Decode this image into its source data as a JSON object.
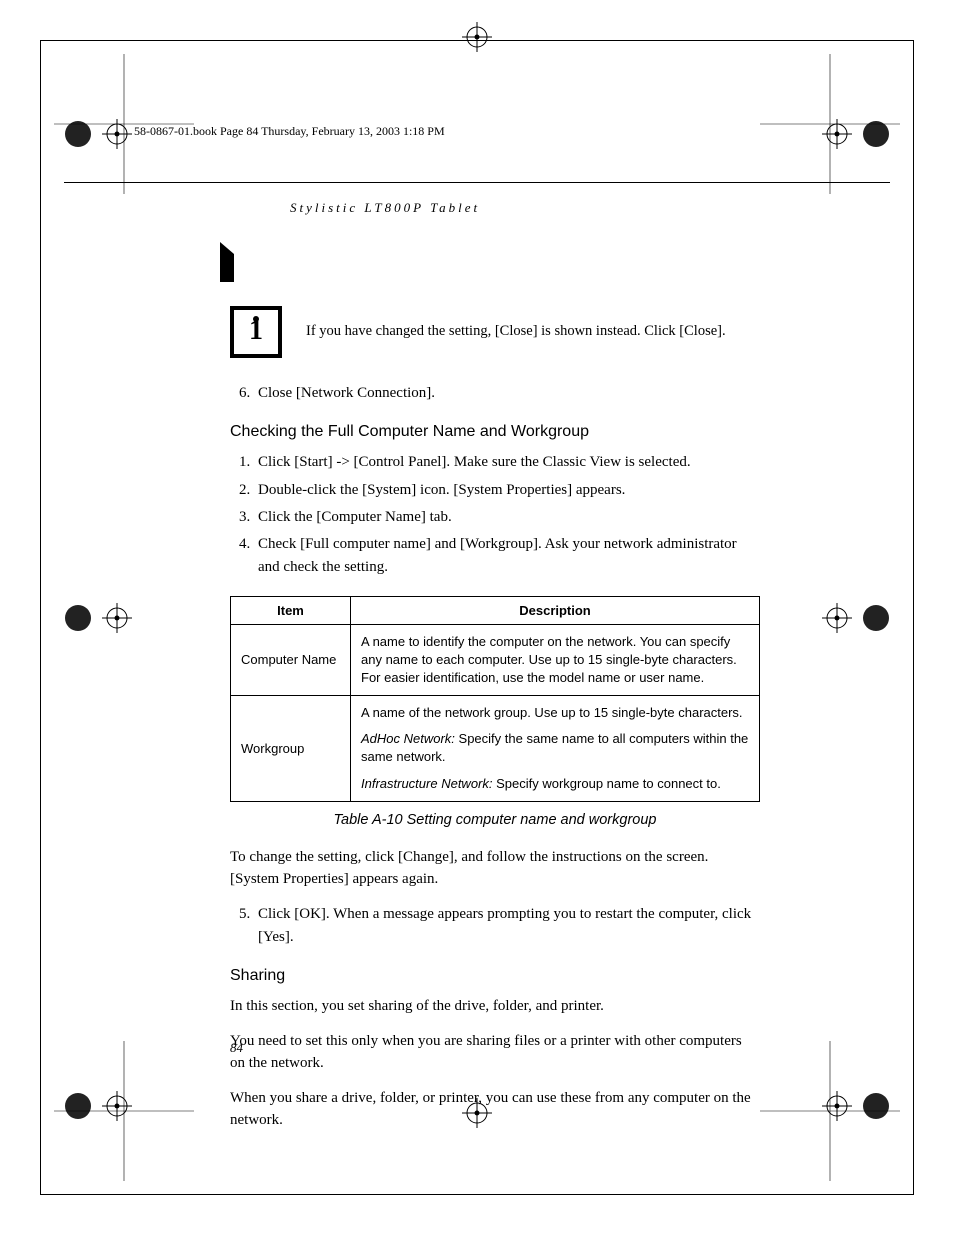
{
  "crop_header": "58-0867-01.book  Page 84  Thursday, February 13, 2003  1:18 PM",
  "running_head": "Stylistic LT800P Tablet",
  "info_note": "If you have changed the setting, [Close] is shown instead. Click [Close].",
  "list_pre": {
    "items": [
      "Close [Network Connection]."
    ],
    "start": 6
  },
  "section1": {
    "heading": "Checking the Full Computer Name and Workgroup",
    "steps": [
      "Click [Start] -> [Control Panel]. Make sure the Classic View is selected.",
      "Double-click the [System] icon. [System Properties] appears.",
      "Click the [Computer Name] tab.",
      "Check [Full computer name] and [Workgroup]. Ask your network administrator and check the setting."
    ]
  },
  "table": {
    "headers": [
      "Item",
      "Description"
    ],
    "rows": [
      {
        "item": "Computer Name",
        "desc": [
          {
            "text": "A name to identify the computer on the network. You can specify any name to each computer. Use up to 15 single-byte characters. For easier identification, use the model name or user name."
          }
        ]
      },
      {
        "item": "Workgroup",
        "desc": [
          {
            "text": "A name of the network group. Use up to 15 single-byte characters."
          },
          {
            "em": "AdHoc Network:",
            "text": " Specify the same name to all computers within the same network."
          },
          {
            "em": "Infrastructure Network:",
            "text": " Specify workgroup name to connect to."
          }
        ]
      }
    ],
    "caption": "Table A-10   Setting computer name and workgroup"
  },
  "after_table_para": "To change the setting, click [Change], and follow the instructions on the screen. [System Properties] appears again.",
  "list_post": {
    "start": 5,
    "items": [
      "Click [OK]. When a message appears prompting you to restart the computer, click [Yes]."
    ]
  },
  "section2": {
    "heading": "Sharing",
    "paras": [
      "In this section, you set sharing of the drive, folder, and printer.",
      "You need to set this only when you are sharing files or a printer with other computers on the network.",
      "When you share a drive, folder, or printer, you can use these from any computer on the network."
    ]
  },
  "page_num": "84"
}
